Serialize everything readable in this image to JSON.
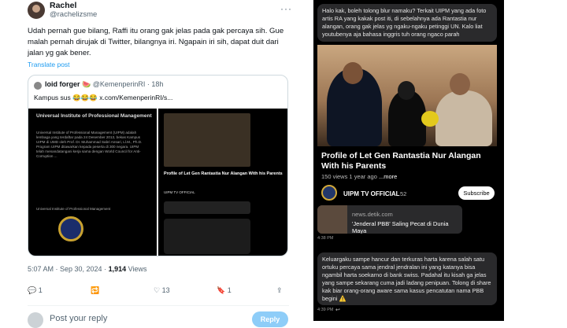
{
  "tweet": {
    "name": "Rachel",
    "handle": "@rachelizsme",
    "more": "···",
    "text": "Udah pernah gue bilang, Raffi itu orang gak jelas pada gak percaya sih. Gue malah pernah dirujak di Twitter, bilangnya iri. Ngapain iri sih, dapat duit dari jalan yg gak bener.",
    "translate": "Translate post",
    "quote": {
      "name": "loid forger",
      "name_emoji": "🍉",
      "handle": "@KemenperinRI · 18h",
      "text": "Kampus sus 😂😂😂 x.com/KemenperinRI/s...",
      "doc_title": "Universal Institute of Professional Management",
      "doc_body": "Universal Institute of Professional Management (UIPM) adalah lembaga yang terdaftar pada 24 Desember 2013, bekas Kampus UIPM di UMD oleh Prof. Dr. Muhammad Sabri Ansari, Ll.M., Ph.D. Program UIPM ditawarkan kepada peserta di 300 negara. UIPM telah menandatangani kerja sama dengan World Council for Anti-Corruption ...",
      "seal_label": "Universal Institute of Professional Management",
      "mini_caption": "Profile of Let Gen Rantastia Nur Alangan With his Parents",
      "mini_channel": "UIPM TV OFFICIAL"
    },
    "meta_time": "5:07 AM · Sep 30, 2024 · ",
    "views": "1,914",
    "views_label": " Views",
    "actions": {
      "reply_count": "1",
      "retweet_count": "",
      "like_count": "13",
      "bookmark_count": "1"
    },
    "reply_placeholder": "Post your reply",
    "reply_button": "Reply"
  },
  "chat": {
    "message1": "Halo kak, boleh tolong blur namaku? Terkait UIPM yang ada foto artis RA yang kakak post iti, di sebelahnya ada Rantastia nur alangan, orang gak jelas yg ngaku-ngaku petinggi UN. Kalo liat youtubenya aja bahasa inggris tuh orang ngaco parah",
    "video_title": "Profile of Let  Gen  Rantastia Nur Alangan With his Parents",
    "video_views": "150 views  1 year ago  ",
    "video_more": "...more",
    "channel_name": "UIPM TV OFFICIAL",
    "channel_subs": "52",
    "subscribe": "Subscribe",
    "news_source": "news.detik.com",
    "news_title": "'Jenderal PBB' Saling Pecat di Dunia Maya",
    "timestamp1": "4:38 PM",
    "message2": "Keluargaku sampe hancur dan terkuras harta karena salah satu ortuku percaya sama jendral jendralan ini yang katanya bisa ngambil harta soekarno di bank swiss. Padahal itu kisah ga jelas yang sampe sekarang cuma jadi ladang penipuan. Tolong di share kak biar orang-orang aware sama kasus pencatutan nama PBB begini ⚠️",
    "timestamp2": "4:39 PM"
  }
}
